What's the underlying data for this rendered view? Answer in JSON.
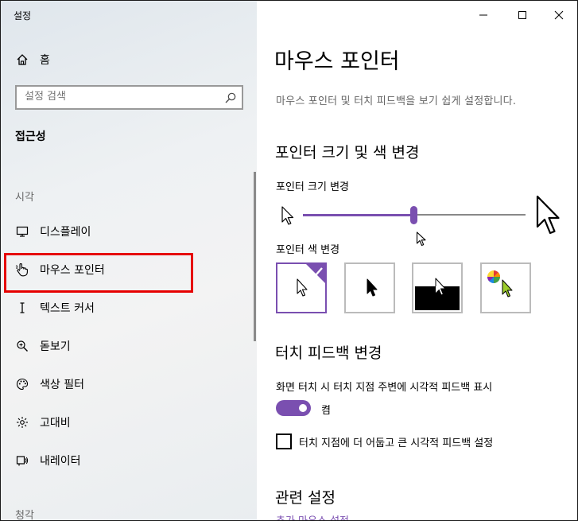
{
  "window": {
    "app_title": "설정",
    "controls": {
      "minimize": "minimize-icon",
      "maximize": "maximize-icon",
      "close": "close-icon"
    }
  },
  "sidebar": {
    "home_label": "홈",
    "search_placeholder": "설정 검색",
    "section_title": "접근성",
    "group_vision": "시각",
    "items": [
      {
        "label": "디스플레이",
        "icon": "monitor-icon"
      },
      {
        "label": "마우스 포인터",
        "icon": "hand-pointer-icon",
        "active": true
      },
      {
        "label": "텍스트 커서",
        "icon": "text-cursor-icon"
      },
      {
        "label": "돋보기",
        "icon": "magnifier-icon"
      },
      {
        "label": "색상 필터",
        "icon": "palette-icon"
      },
      {
        "label": "고대비",
        "icon": "contrast-icon"
      },
      {
        "label": "내레이터",
        "icon": "narrator-icon"
      }
    ],
    "group_hearing": "청각"
  },
  "main": {
    "title": "마우스 포인터",
    "description": "마우스 포인터 및 터치 피드백을 보기 쉽게 설정합니다.",
    "pointer_section_title": "포인터 크기 및 색 변경",
    "size_label": "포인터 크기 변경",
    "size_level": 0.5,
    "color_label": "포인터 색 변경",
    "color_options": [
      "white",
      "black",
      "inverted",
      "custom"
    ],
    "selected_color": "white",
    "touch_section_title": "터치 피드백 변경",
    "touch_label": "화면 터치 시 터치 지점 주변에 시각적 피드백 표시",
    "toggle_state": "켬",
    "checkbox_label": "터치 지점에 더 어둡고 큰 시각적 피드백 설정",
    "checkbox_checked": false,
    "related_title": "관련 설정",
    "related_link": "추가 마우스 설정"
  },
  "colors": {
    "accent": "#7a4fb0",
    "highlight": "#e60000"
  }
}
